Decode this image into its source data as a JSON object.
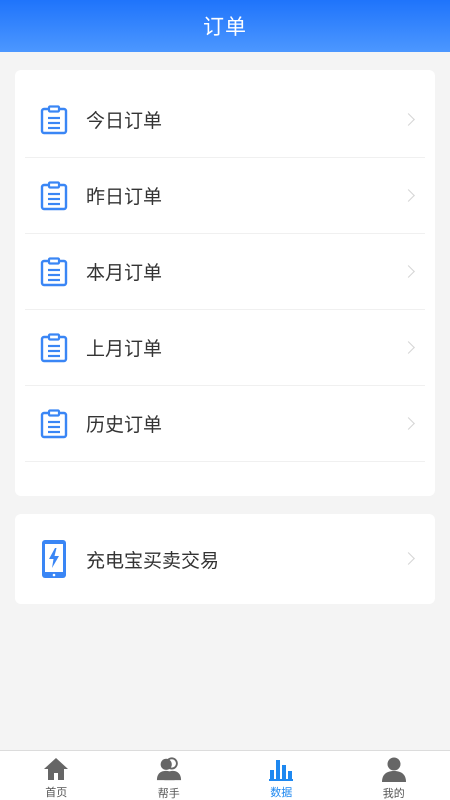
{
  "header": {
    "title": "订单"
  },
  "orders": {
    "items": [
      {
        "label": "今日订单",
        "icon": "clipboard-icon"
      },
      {
        "label": "昨日订单",
        "icon": "clipboard-icon"
      },
      {
        "label": "本月订单",
        "icon": "clipboard-icon"
      },
      {
        "label": "上月订单",
        "icon": "clipboard-icon"
      },
      {
        "label": "历史订单",
        "icon": "clipboard-icon"
      }
    ]
  },
  "trade": {
    "label": "充电宝买卖交易",
    "icon": "phone-charge-icon"
  },
  "tabbar": {
    "active": "数据",
    "tabs": [
      {
        "label": "首页",
        "icon": "home-icon"
      },
      {
        "label": "帮手",
        "icon": "users-icon"
      },
      {
        "label": "数据",
        "icon": "bar-chart-icon"
      },
      {
        "label": "我的",
        "icon": "person-icon"
      }
    ]
  },
  "colors": {
    "accent": "#1f74fb",
    "icon_blue": "#3a86f5",
    "tab_active": "#1e88f0",
    "tab_inactive": "#666666"
  }
}
